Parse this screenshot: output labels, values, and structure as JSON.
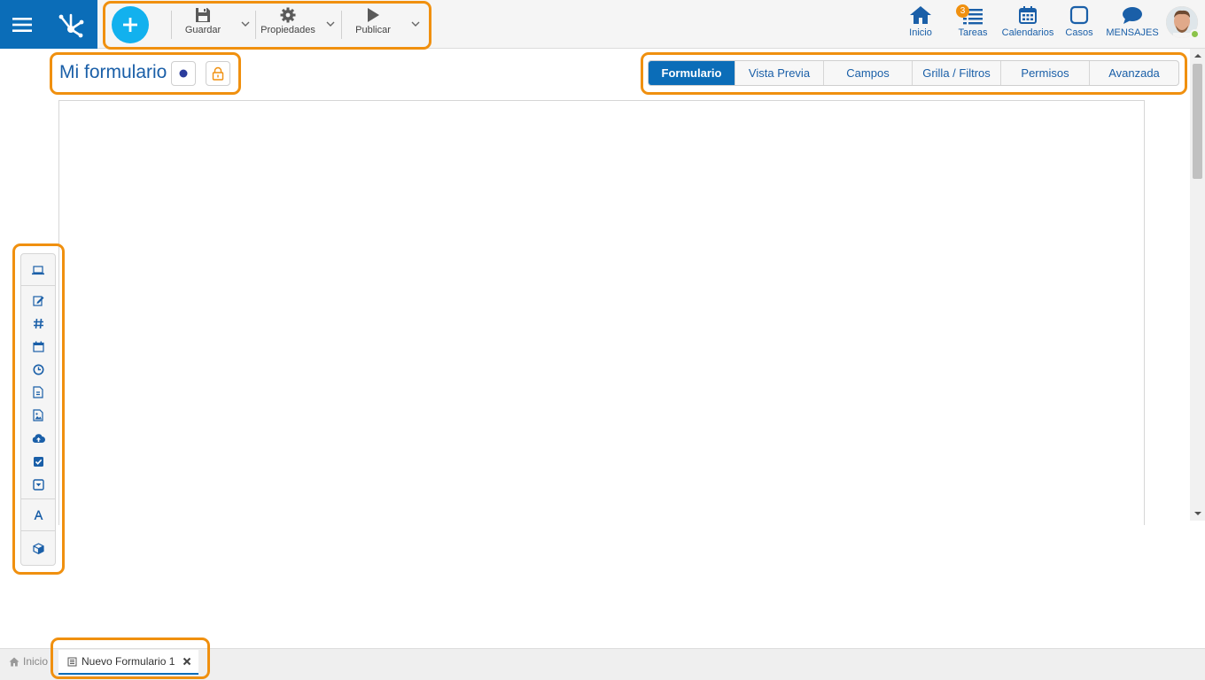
{
  "toolbar": {
    "save_label": "Guardar",
    "properties_label": "Propiedades",
    "publish_label": "Publicar"
  },
  "nav": {
    "home_label": "Inicio",
    "tasks_label": "Tareas",
    "tasks_badge": "3",
    "calendars_label": "Calendarios",
    "cases_label": "Casos",
    "messages_label": "MENSAJES"
  },
  "form": {
    "title": "Mi formulario"
  },
  "tabs": [
    {
      "label": "Formulario",
      "active": true
    },
    {
      "label": "Vista Previa",
      "active": false
    },
    {
      "label": "Campos",
      "active": false
    },
    {
      "label": "Grilla / Filtros",
      "active": false
    },
    {
      "label": "Permisos",
      "active": false
    },
    {
      "label": "Avanzada",
      "active": false
    }
  ],
  "toolbox": {
    "items": [
      "laptop-icon",
      "edit-icon",
      "hash-icon",
      "calendar-icon",
      "clock-icon",
      "file-icon",
      "image-icon",
      "upload-cloud-icon",
      "checkbox-icon",
      "dropdown-icon",
      "text-icon",
      "cube-icon"
    ]
  },
  "bottom": {
    "home_label": "Inicio",
    "tab_label": "Nuevo Formulario 1"
  },
  "colors": {
    "primary": "#0b6db8",
    "accent": "#12b1ee",
    "highlight": "#f0900f",
    "link": "#1a5fa8"
  }
}
